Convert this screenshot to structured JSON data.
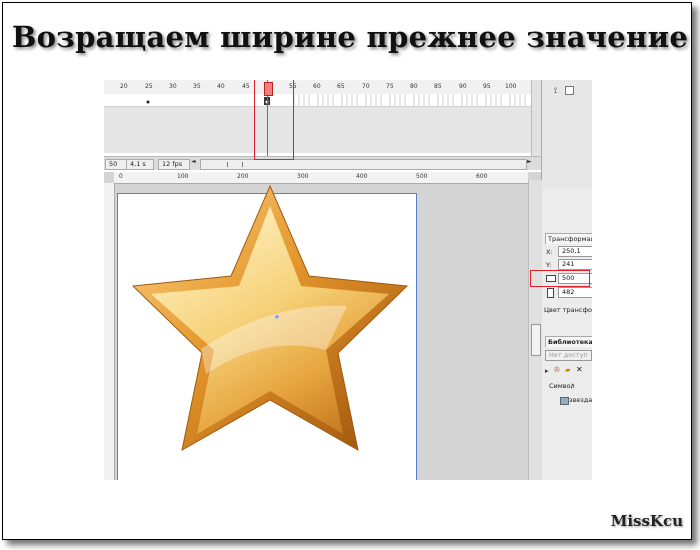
{
  "slide": {
    "title": "Возращаем ширине прежнее значение",
    "author": "MissKcu"
  },
  "timeline": {
    "ruler_labels": [
      "20",
      "25",
      "30",
      "35",
      "40",
      "45",
      "50",
      "55",
      "60",
      "65",
      "70",
      "75",
      "80",
      "85",
      "90",
      "95",
      "100"
    ],
    "status": {
      "frame": "50",
      "time": "4,1 s",
      "fps": "12 fps"
    }
  },
  "stage_ruler": {
    "labels": [
      "0",
      "100",
      "200",
      "300",
      "400",
      "500",
      "600"
    ]
  },
  "transform_panel": {
    "tab": "Трансформаци",
    "x_label": "X:",
    "x_value": "250,1",
    "y_label": "Y:",
    "y_value": "241",
    "width_value": "500",
    "height_value": "482",
    "color_label": "Цвет трансфор"
  },
  "library_panel": {
    "tab": "Библиотека",
    "status": "Нет доступ",
    "column": "Символ",
    "sort_glyph": "/",
    "item": "звезда"
  },
  "colors": {
    "highlight_box": "#e0202a",
    "star_outer": "#b86a12",
    "star_inner": "#ffe9a8"
  }
}
